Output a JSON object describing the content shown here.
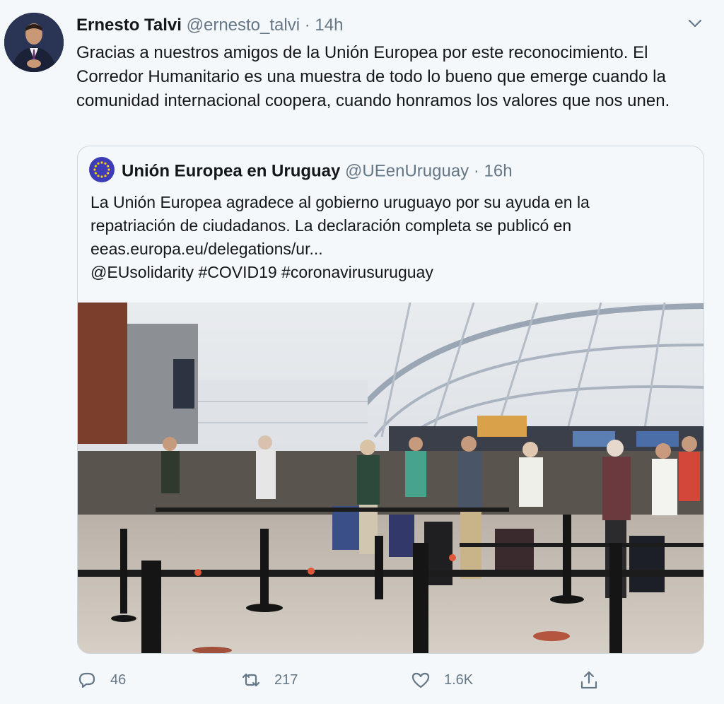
{
  "tweet": {
    "author_name": "Ernesto Talvi",
    "author_handle": "@ernesto_talvi",
    "separator": "·",
    "time": "14h",
    "text": "Gracias a nuestros amigos de la Unión Europea por este reconocimiento. El Corredor Humanitario es una muestra de todo lo bueno que emerge cuando la comunidad internacional coopera, cuando honramos los valores que nos unen."
  },
  "quoted": {
    "author_name": "Unión Europea en Uruguay",
    "author_handle": "@UEenUruguay",
    "separator": "·",
    "time": "16h",
    "line1": "La Unión Europea agradece al gobierno uruguayo por su ayuda en la",
    "line2": "repatriación de ciudadanos. La declaración completa se publicó en",
    "line3": "eeas.europa.eu/delegations/ur...",
    "line4": "@EUsolidarity #COVID19 #coronavirusuruguay"
  },
  "actions": {
    "reply_count": "46",
    "retweet_count": "217",
    "like_count": "1.6K"
  },
  "icons": {
    "caret": "chevron-down-icon",
    "reply": "reply-icon",
    "retweet": "retweet-icon",
    "like": "heart-icon",
    "share": "share-icon"
  },
  "colors": {
    "background": "#f5f8fa",
    "secondary_text": "#657786",
    "eu_blue": "#3e3bb8",
    "eu_star": "#ffcc00"
  }
}
